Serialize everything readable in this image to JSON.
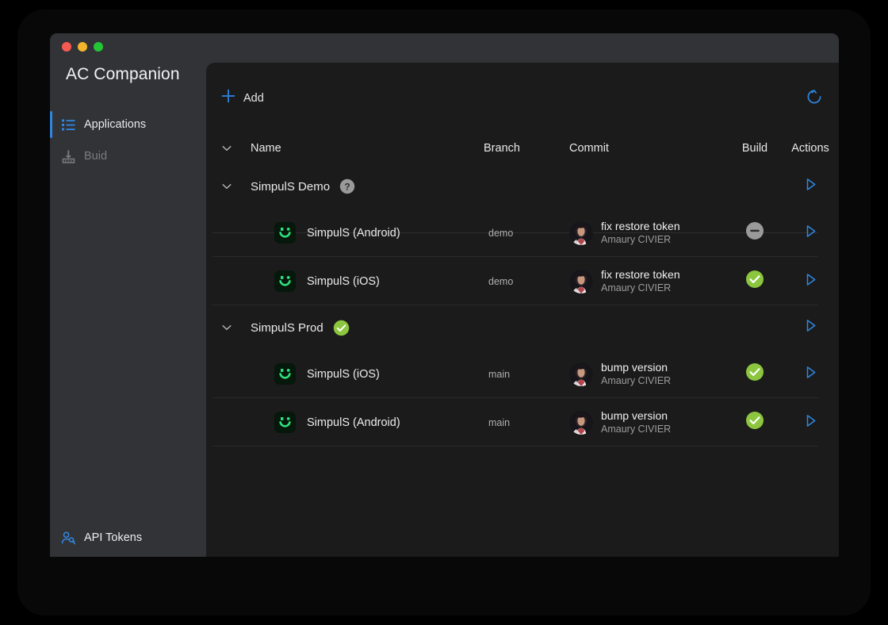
{
  "window": {
    "title": "AC Companion",
    "traffic_lights": [
      {
        "name": "close-button",
        "color": "#f45a52"
      },
      {
        "name": "minimize-button",
        "color": "#f2b42c"
      },
      {
        "name": "maximize-button",
        "color": "#24c636"
      }
    ]
  },
  "sidebar": {
    "items": [
      {
        "label": "Applications",
        "icon": "list-icon",
        "active": true,
        "disabled": false
      },
      {
        "label": "Buid",
        "icon": "build-icon",
        "active": false,
        "disabled": true
      }
    ],
    "footer": {
      "label": "API Tokens",
      "icon": "api-key-icon"
    }
  },
  "toolbar": {
    "add_label": "Add",
    "add_icon": "plus-icon",
    "refresh_icon": "refresh-icon"
  },
  "table": {
    "columns": [
      "Name",
      "Branch",
      "Commit",
      "Build",
      "Actions"
    ],
    "groups": [
      {
        "name": "SimpulS Demo",
        "status": "unknown",
        "status_icon": "question-badge-icon",
        "expanded": true,
        "rows": [
          {
            "app": "SimpulS (Android)",
            "app_icon": "simpuls-app-icon",
            "branch": "demo",
            "commit_message": "fix restore token",
            "commit_author": "Amaury CIVIER",
            "build_status": "disabled",
            "build_icon": "minus-badge-icon",
            "action_icon": "play-icon"
          },
          {
            "app": "SimpulS (iOS)",
            "app_icon": "simpuls-app-icon",
            "branch": "demo",
            "commit_message": "fix restore token",
            "commit_author": "Amaury CIVIER",
            "build_status": "success",
            "build_icon": "check-badge-icon",
            "action_icon": "play-icon"
          }
        ]
      },
      {
        "name": "SimpulS Prod",
        "status": "success",
        "status_icon": "check-badge-icon",
        "expanded": true,
        "rows": [
          {
            "app": "SimpulS (iOS)",
            "app_icon": "simpuls-app-icon",
            "branch": "main",
            "commit_message": "bump version",
            "commit_author": "Amaury CIVIER",
            "build_status": "success",
            "build_icon": "check-badge-icon",
            "action_icon": "play-icon"
          },
          {
            "app": "SimpulS (Android)",
            "app_icon": "simpuls-app-icon",
            "branch": "main",
            "commit_message": "bump version",
            "commit_author": "Amaury CIVIER",
            "build_status": "success",
            "build_icon": "check-badge-icon",
            "action_icon": "play-icon"
          }
        ]
      }
    ]
  },
  "colors": {
    "accent": "#2f86e0",
    "success": "#8cc63f",
    "neutral": "#9a9a9a",
    "panel_bg": "#1b1b1b",
    "sidebar_bg": "#323337"
  }
}
